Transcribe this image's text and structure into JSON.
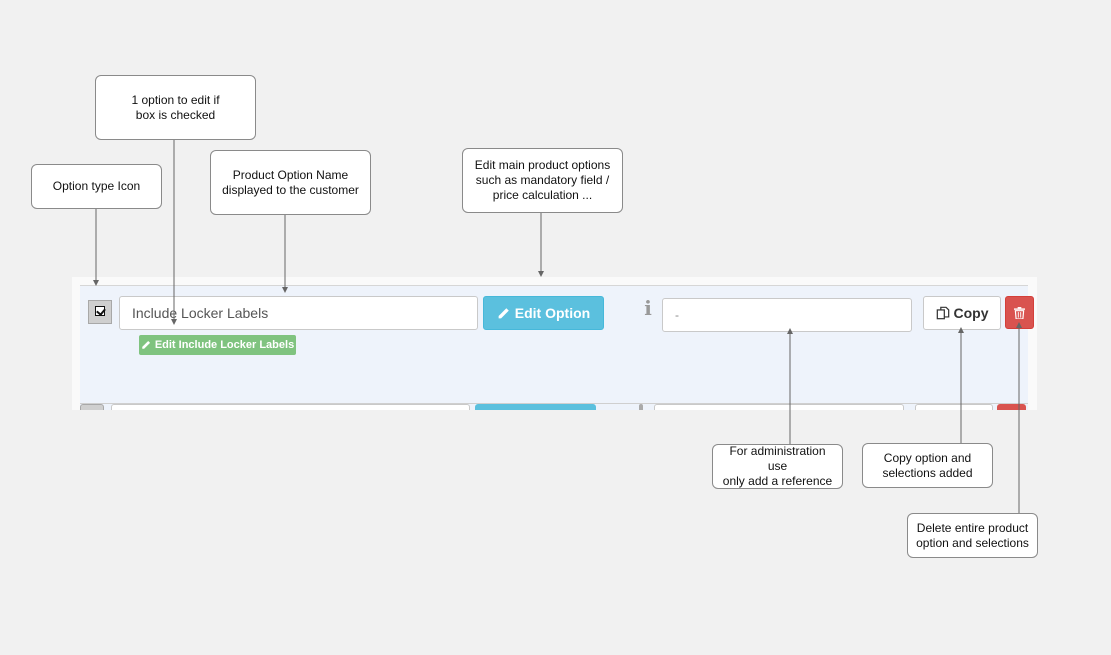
{
  "callouts": {
    "option_icon": "Option type Icon",
    "one_option": "1 option to edit if\nbox is checked",
    "option_name": "Product Option Name\ndisplayed to the customer",
    "edit_main": "Edit main product options\nsuch as mandatory field /\nprice calculation ...",
    "admin_ref": "For administration use\nonly add a reference",
    "copy_option": "Copy option and\nselections added",
    "delete_option": "Delete entire product\noption and selections"
  },
  "row": {
    "option_name_value": "Include Locker Labels",
    "edit_option_label": "Edit Option",
    "reference_value": "-",
    "copy_label": "Copy",
    "edit_sub_label": "Edit Include Locker Labels"
  },
  "icons": {
    "option_type": "checkbox-icon",
    "edit": "pencil-icon",
    "info": "info-icon",
    "copy": "copy-icon",
    "delete": "trash-icon"
  },
  "colors": {
    "edit_option": "#5bc0de",
    "edit_sub": "#7fc37f",
    "delete": "#d9534f",
    "row_bg": "#eef3fb"
  }
}
